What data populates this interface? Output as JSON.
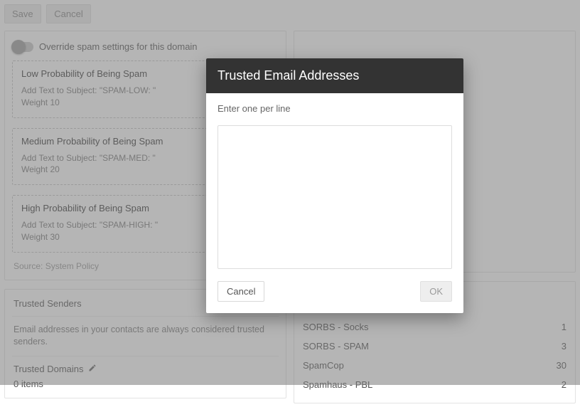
{
  "toolbar": {
    "save": "Save",
    "cancel": "Cancel"
  },
  "override": {
    "label": "Override spam settings for this domain"
  },
  "spam_levels": [
    {
      "title": "Low Probability of Being Spam",
      "action": "Add Text to Subject: \"SPAM-LOW: \"",
      "weight": "Weight 10"
    },
    {
      "title": "Medium Probability of Being Spam",
      "action": "Add Text to Subject: \"SPAM-MED: \"",
      "weight": "Weight 20"
    },
    {
      "title": "High Probability of Being Spam",
      "action": "Add Text to Subject: \"SPAM-HIGH: \"",
      "weight": "Weight 30"
    }
  ],
  "source_line": "Source: System Policy",
  "trusted_senders": {
    "title": "Trusted Senders",
    "note": "Email addresses in your contacts are always considered trusted senders.",
    "domains_label": "Trusted Domains",
    "items_count": "0 items"
  },
  "ip_services": [
    {
      "name": "SORBS - Socks",
      "value": "1"
    },
    {
      "name": "SORBS - SPAM",
      "value": "3"
    },
    {
      "name": "SpamCop",
      "value": "30"
    },
    {
      "name": "Spamhaus - PBL",
      "value": "2"
    }
  ],
  "modal": {
    "title": "Trusted Email Addresses",
    "instruction": "Enter one per line",
    "value": "",
    "cancel": "Cancel",
    "ok": "OK"
  }
}
